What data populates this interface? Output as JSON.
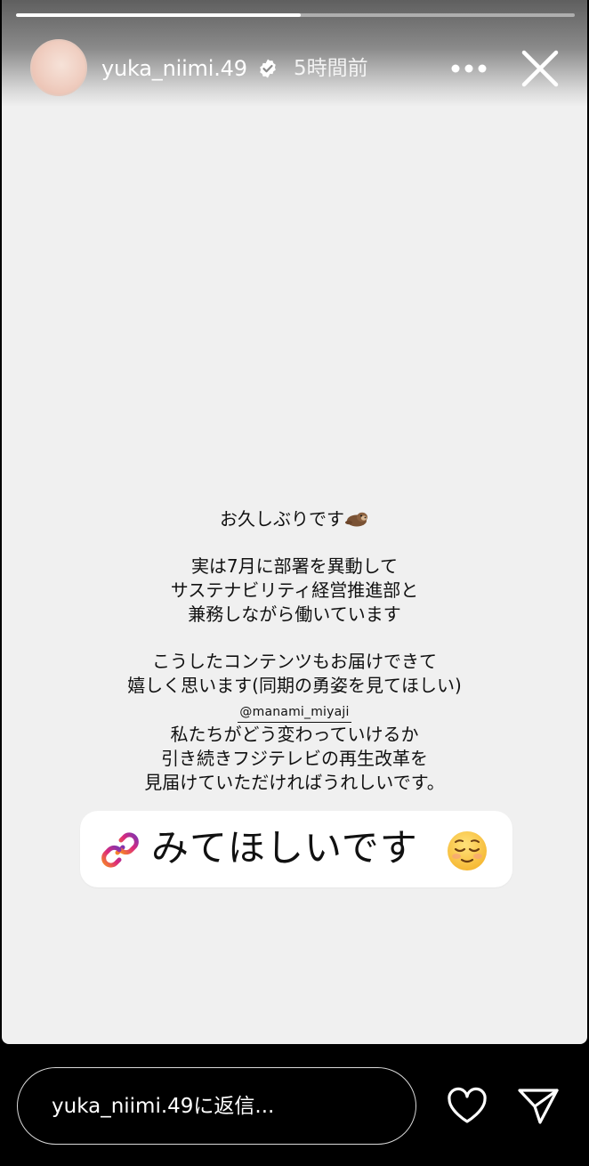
{
  "progress": {
    "fraction": 0.51
  },
  "header": {
    "username": "yuka_niimi.49",
    "verified": true,
    "time_ago": "5時間前",
    "more_icon": "more-horizontal-icon",
    "close_icon": "close-icon"
  },
  "story": {
    "background": "#f0f0f0",
    "text": {
      "line1": "お久しぶりです",
      "line1_emoji": "otter-emoji",
      "line2": "実は7月に部署を異動して",
      "line3": "サステナビリティ経営推進部と",
      "line4": "兼務しながら働いています",
      "line5": "こうしたコンテンツもお届けできて",
      "line6": "嬉しく思います(同期の勇姿を見てほしい)",
      "mention": "@manami_miyaji",
      "line7": "私たちがどう変わっていけるか",
      "line8": "引き続きフジテレビの再生改革を",
      "line9": "見届けていただければうれしいです。"
    },
    "link_sticker": {
      "label": "みてほしいです",
      "icon": "link-icon",
      "emoji": "relieved-face-emoji"
    }
  },
  "footer": {
    "reply_placeholder": "yuka_niimi.49に返信...",
    "heart_icon": "heart-icon",
    "send_icon": "send-icon"
  },
  "colors": {
    "accent_link_start": "#f58529",
    "accent_link_mid": "#dd2a7b",
    "accent_link_end": "#8134af",
    "verified": "#ffffff"
  }
}
